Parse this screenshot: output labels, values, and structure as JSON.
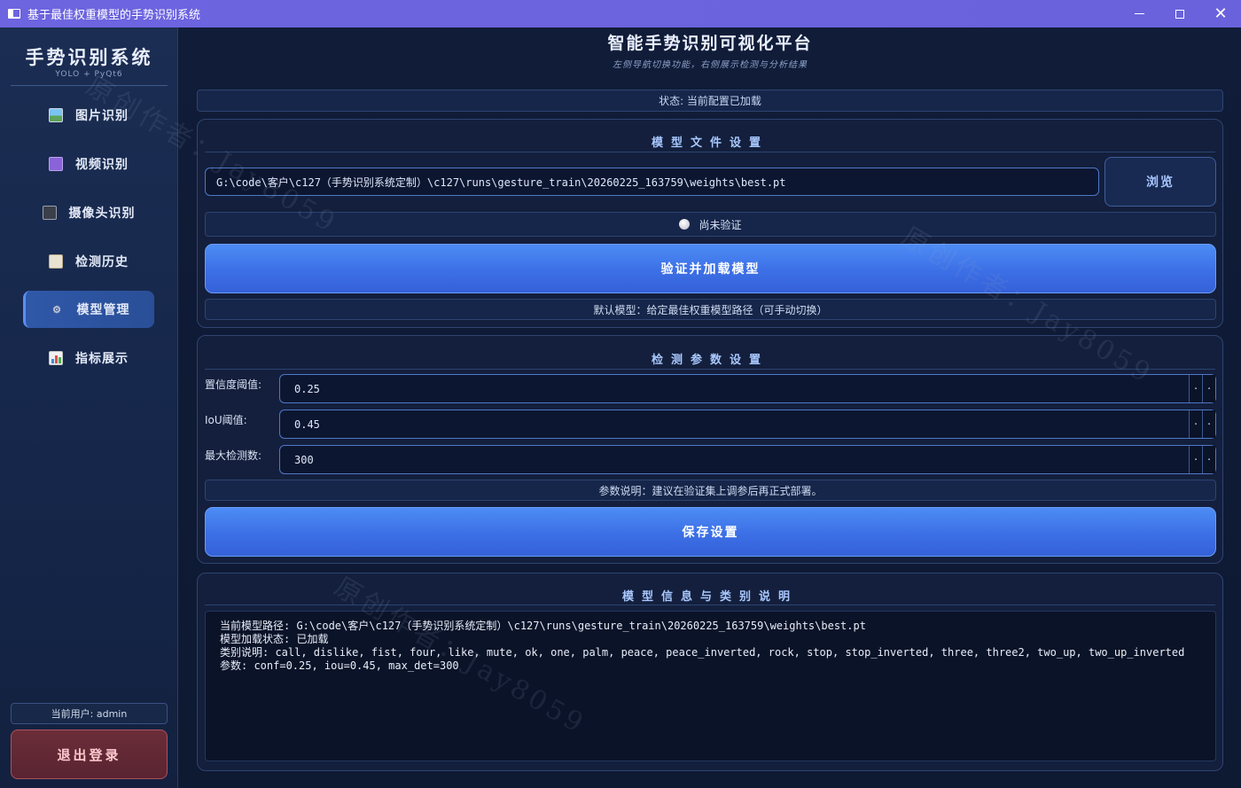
{
  "window": {
    "title": "基于最佳权重模型的手势识别系统",
    "controls": [
      "minimize",
      "maximize",
      "close"
    ]
  },
  "sidebar": {
    "brand": "手势识别系统",
    "brand_sub": "YOLO + PyQt6",
    "items": [
      {
        "label": "图片识别",
        "icon": "image-icon",
        "active": false
      },
      {
        "label": "视频识别",
        "icon": "clapperboard-icon",
        "active": false
      },
      {
        "label": "摄像头识别",
        "icon": "camera-icon",
        "active": false
      },
      {
        "label": "检测历史",
        "icon": "clipboard-icon",
        "active": false
      },
      {
        "label": "模型管理",
        "icon": "gear-icon",
        "active": true
      },
      {
        "label": "指标展示",
        "icon": "bar-chart-icon",
        "active": false
      }
    ],
    "current_user": "当前用户: admin",
    "logout_label": "退出登录"
  },
  "header": {
    "title": "智能手势识别可视化平台",
    "subtitle": "左侧导航切换功能，右侧展示检测与分析结果",
    "status": "状态: 当前配置已加载"
  },
  "model_panel": {
    "title": "模型文件设置",
    "path_value": "G:\\code\\客户\\c127（手势识别系统定制）\\c127\\runs\\gesture_train\\20260225_163759\\weights\\best.pt",
    "browse_label": "浏览",
    "verify_state": "尚未验证",
    "verify_button": "验证并加载模型",
    "default_note": "默认模型：给定最佳权重模型路径（可手动切换）"
  },
  "params_panel": {
    "title": "检测参数设置",
    "conf_label": "置信度阈值:",
    "conf_value": "0.25",
    "iou_label": "IoU阈值:",
    "iou_value": "0.45",
    "maxdet_label": "最大检测数:",
    "maxdet_value": "300",
    "note": "参数说明：建议在验证集上调参后再正式部署。",
    "save_button": "保存设置"
  },
  "info_panel": {
    "title": "模型信息与类别说明",
    "lines": [
      "当前模型路径: G:\\code\\客户\\c127（手势识别系统定制）\\c127\\runs\\gesture_train\\20260225_163759\\weights\\best.pt",
      "模型加载状态: 已加载",
      "类别说明: call, dislike, fist, four, like, mute, ok, one, palm, peace, peace_inverted, rock, stop, stop_inverted, three, three2, two_up, two_up_inverted",
      "参数: conf=0.25, iou=0.45, max_det=300"
    ]
  },
  "watermarks": [
    "原创作者：Jay8059",
    "原创作者：Jay8059",
    "原创作者：Jay8059"
  ],
  "colors": {
    "titlebar": "#6d64e0",
    "accent": "#3c6fe6",
    "sidebar_active": "#2f58a8",
    "logout": "#6a2d38"
  }
}
